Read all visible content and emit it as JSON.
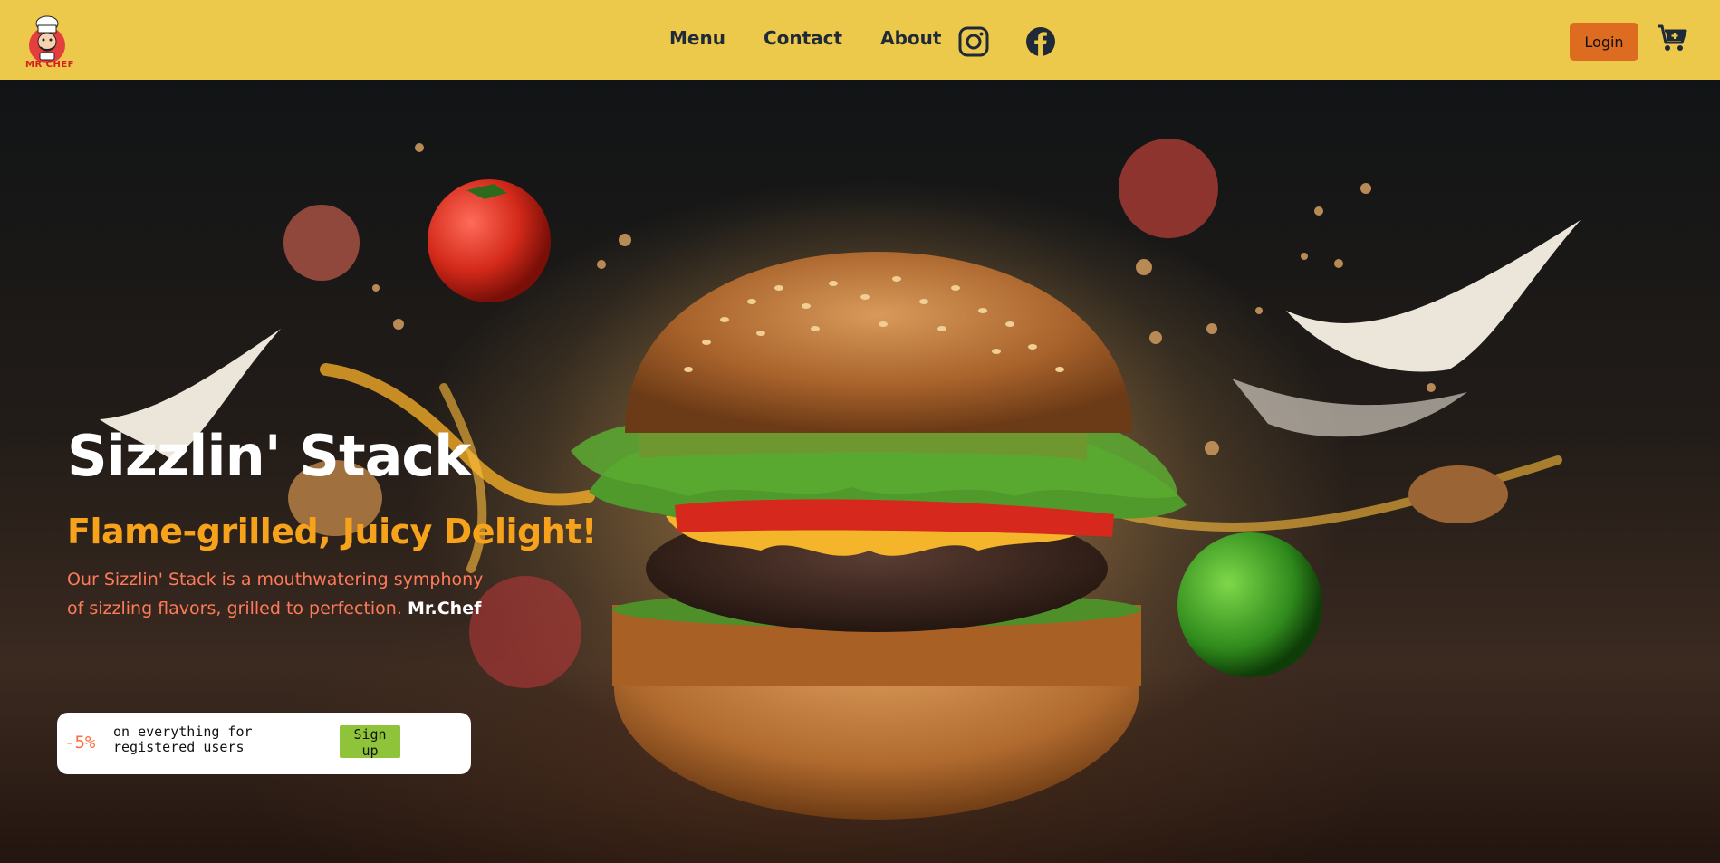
{
  "nav": {
    "logo_text": "MR CHEF",
    "links": [
      "Menu",
      "Contact",
      "About"
    ],
    "login_label": "Login",
    "icons": [
      "instagram-icon",
      "facebook-icon",
      "cart-icon"
    ]
  },
  "hero": {
    "title": "Sizzlin' Stack",
    "subtitle": "Flame-grilled, Juicy Delight!",
    "description": "Our Sizzlin' Stack is a mouthwatering symphony of sizzling flavors, grilled to perfection.",
    "brand": "Mr.Chef"
  },
  "promo": {
    "discount": "-5%",
    "text": "on everything for registered users",
    "signup_label": "Sign up"
  },
  "colors": {
    "navbar": "#ecc94b",
    "login_button": "#dd6b20",
    "subtitle": "#f6a21b",
    "description": "#ff7a59",
    "signup_button": "#8fc33a"
  }
}
